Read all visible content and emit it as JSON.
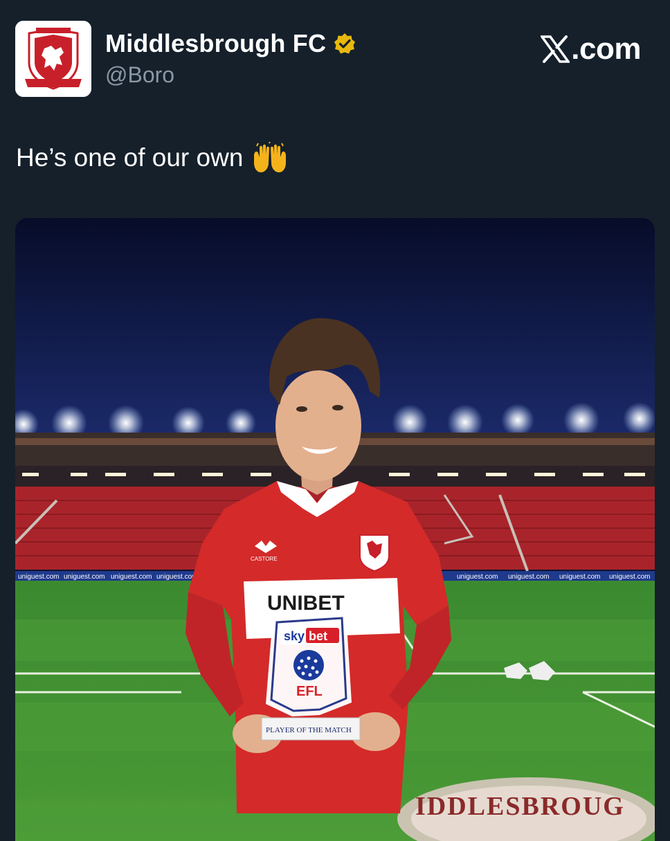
{
  "account": {
    "display_name": "Middlesbrough FC",
    "handle": "@Boro",
    "verified": true,
    "verified_badge_color": "#e8b80c",
    "avatar_icon": "middlesbrough-crest-icon"
  },
  "brand": {
    "text": ".com",
    "logo_icon": "x-logo-icon"
  },
  "tweet": {
    "text": "He’s one of our own",
    "emoji_icon": "raising-hands-emoji-icon"
  },
  "media": {
    "shirt_sponsor": "UNIBET",
    "kit_brand": "CASTORE",
    "trophy": {
      "sponsor_sky": "sky",
      "sponsor_bet": "bet",
      "league": "EFL",
      "award": "PLAYER OF THE MATCH"
    },
    "board_ads": [
      "uniguest.com",
      "uniguest.com",
      "uniguest.com",
      "uniguest.com",
      "uniguest.com",
      "uniguest.com",
      "uniguest.com",
      "uniguest.com",
      "uniguest.com",
      "uniguest.com"
    ],
    "pitch_logo_text": "IDDLESBROUG",
    "colors": {
      "shirt_red": "#d42a2a",
      "pitch_green": "#3f8a2e",
      "sky_navy": "#0a1135",
      "seats_red": "#a8242a"
    }
  }
}
